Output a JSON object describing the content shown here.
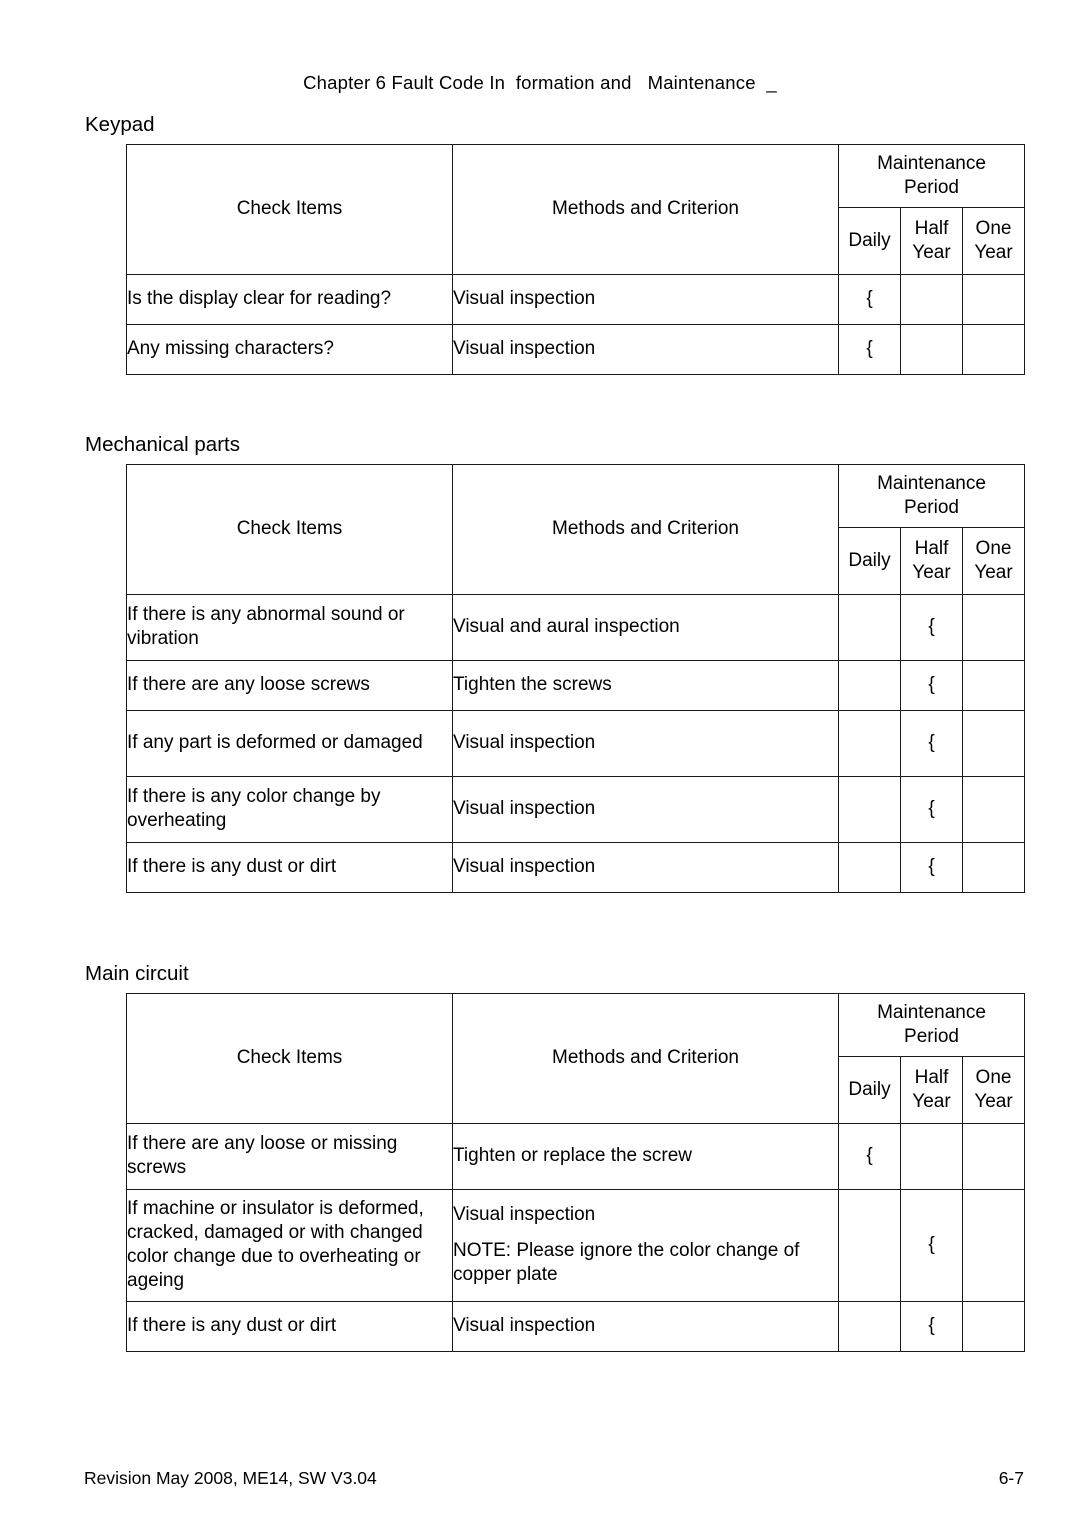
{
  "header": {
    "running_title": "Chapter 6 Fault Code In  formation and   Maintenance  _"
  },
  "columns": {
    "check_items": "Check Items",
    "methods": "Methods and Criterion",
    "period_group": "Maintenance\nPeriod",
    "period_group_line1": "Maintenance",
    "period_group_line2": "Period",
    "daily": "Daily",
    "half_year_line1": "Half",
    "half_year_line2": "Year",
    "one_year_line1": "One",
    "one_year_line2": "Year"
  },
  "mark": "{",
  "sections": [
    {
      "label": "Keypad",
      "rows": [
        {
          "item": "Is the display clear for reading?",
          "method": "Visual inspection",
          "note": "",
          "daily": "{",
          "half_year": "",
          "one_year": ""
        },
        {
          "item": "Any missing characters?",
          "method": "Visual inspection",
          "note": "",
          "daily": "{",
          "half_year": "",
          "one_year": ""
        }
      ]
    },
    {
      "label": "Mechanical parts",
      "rows": [
        {
          "item": "If there is any abnormal sound or vibration",
          "method": "Visual and aural inspection",
          "note": "",
          "daily": "",
          "half_year": "{",
          "one_year": ""
        },
        {
          "item": "If there are any loose screws",
          "method": "Tighten the screws",
          "note": "",
          "daily": "",
          "half_year": "{",
          "one_year": ""
        },
        {
          "item": "If any part is deformed or damaged",
          "method": "Visual inspection",
          "note": "",
          "daily": "",
          "half_year": "{",
          "one_year": ""
        },
        {
          "item": "If there is any color change by overheating",
          "method": "Visual inspection",
          "note": "",
          "daily": "",
          "half_year": "{",
          "one_year": ""
        },
        {
          "item": "If there is any dust or dirt",
          "method": "Visual inspection",
          "note": "",
          "daily": "",
          "half_year": "{",
          "one_year": ""
        }
      ]
    },
    {
      "label": "Main circuit",
      "rows": [
        {
          "item": "If there are any loose or missing screws",
          "method": "Tighten or replace the screw",
          "note": "",
          "daily": "{",
          "half_year": "",
          "one_year": ""
        },
        {
          "item": "If machine or insulator is deformed, cracked, damaged or with changed color change due to overheating or ageing",
          "method": "Visual inspection",
          "note": "NOTE: Please ignore the color change of copper plate",
          "daily": "",
          "half_year": "{",
          "one_year": ""
        },
        {
          "item": "If there is any dust or dirt",
          "method": "Visual inspection",
          "note": "",
          "daily": "",
          "half_year": "{",
          "one_year": ""
        }
      ]
    }
  ],
  "footer": {
    "revision": "Revision May 2008, ME14, SW V3.04",
    "page_number": "6-7"
  }
}
